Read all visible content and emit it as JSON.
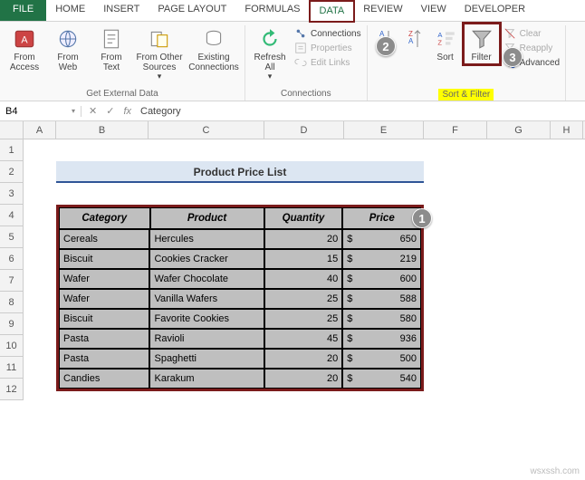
{
  "tabs": {
    "file": "FILE",
    "home": "HOME",
    "insert": "INSERT",
    "page": "PAGE LAYOUT",
    "formulas": "FORMULAS",
    "data": "DATA",
    "review": "REVIEW",
    "view": "VIEW",
    "developer": "DEVELOPER"
  },
  "ribbon": {
    "ext": {
      "access": "From Access",
      "web": "From Web",
      "text": "From Text",
      "other": "From Other Sources",
      "other2": "",
      "existing": "Existing Connections",
      "label": "Get External Data"
    },
    "conn": {
      "refresh": "Refresh All",
      "refresh2": "",
      "c1": "Connections",
      "c2": "Properties",
      "c3": "Edit Links",
      "label": "Connections"
    },
    "sort": {
      "sort": "Sort",
      "filter": "Filter",
      "f1": "Clear",
      "f2": "Reapply",
      "f3": "Advanced",
      "label": "Sort & Filter"
    }
  },
  "fbar": {
    "name": "B4",
    "fx": "fx",
    "value": "Category"
  },
  "cols": [
    "A",
    "B",
    "C",
    "D",
    "E",
    "F",
    "G",
    "H"
  ],
  "rows": [
    "1",
    "2",
    "3",
    "4",
    "5",
    "6",
    "7",
    "8",
    "9",
    "10",
    "11",
    "12"
  ],
  "title": "Product Price List",
  "headers": {
    "cat": "Category",
    "prod": "Product",
    "qty": "Quantity",
    "price": "Price"
  },
  "data": [
    {
      "cat": "Cereals",
      "prod": "Hercules",
      "qty": "20",
      "cur": "$",
      "price": "650"
    },
    {
      "cat": "Biscuit",
      "prod": "Cookies Cracker",
      "qty": "15",
      "cur": "$",
      "price": "219"
    },
    {
      "cat": "Wafer",
      "prod": "Wafer Chocolate",
      "qty": "40",
      "cur": "$",
      "price": "600"
    },
    {
      "cat": "Wafer",
      "prod": "Vanilla Wafers",
      "qty": "25",
      "cur": "$",
      "price": "588"
    },
    {
      "cat": "Biscuit",
      "prod": "Favorite Cookies",
      "qty": "25",
      "cur": "$",
      "price": "580"
    },
    {
      "cat": "Pasta",
      "prod": "Ravioli",
      "qty": "45",
      "cur": "$",
      "price": "936"
    },
    {
      "cat": "Pasta",
      "prod": "Spaghetti",
      "qty": "20",
      "cur": "$",
      "price": "500"
    },
    {
      "cat": "Candies",
      "prod": "Karakum",
      "qty": "20",
      "cur": "$",
      "price": "540"
    }
  ],
  "callouts": {
    "c1": "1",
    "c2": "2",
    "c3": "3"
  },
  "watermark": "wsxssh.com",
  "chart_data": {
    "type": "table",
    "title": "Product Price List",
    "columns": [
      "Category",
      "Product",
      "Quantity",
      "Price"
    ],
    "rows": [
      [
        "Cereals",
        "Hercules",
        20,
        650
      ],
      [
        "Biscuit",
        "Cookies Cracker",
        15,
        219
      ],
      [
        "Wafer",
        "Wafer Chocolate",
        40,
        600
      ],
      [
        "Wafer",
        "Vanilla Wafers",
        25,
        588
      ],
      [
        "Biscuit",
        "Favorite Cookies",
        25,
        580
      ],
      [
        "Pasta",
        "Ravioli",
        45,
        936
      ],
      [
        "Pasta",
        "Spaghetti",
        20,
        500
      ],
      [
        "Candies",
        "Karakum",
        20,
        540
      ]
    ],
    "currency": "$"
  }
}
